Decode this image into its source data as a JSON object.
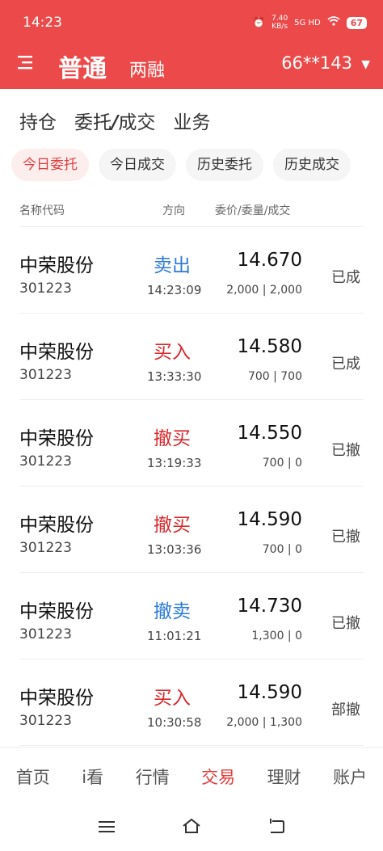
{
  "status_bar": {
    "time": "14:23",
    "speed": "7.40",
    "speed_unit": "KB/s",
    "network": "5G HD",
    "battery": "67"
  },
  "nav": {
    "mode_active": "普通",
    "mode_other": "两融",
    "account": "66**143"
  },
  "main_tabs": [
    {
      "label": "持仓"
    },
    {
      "label_a": "委托",
      "label_slash": "/",
      "label_b": "成交"
    },
    {
      "label": "业务"
    }
  ],
  "subtabs": [
    "今日委托",
    "今日成交",
    "历史委托",
    "历史成交"
  ],
  "columns": {
    "name": "名称代码",
    "direction": "方向",
    "price": "委价/委量/成交"
  },
  "orders": [
    {
      "name": "中荣股份",
      "code": "301223",
      "direction": "卖出",
      "time": "14:23:09",
      "price": "14.670",
      "qty": "2,000 | 2,000",
      "status": "已成"
    },
    {
      "name": "中荣股份",
      "code": "301223",
      "direction": "买入",
      "time": "13:33:30",
      "price": "14.580",
      "qty": "700 | 700",
      "status": "已成"
    },
    {
      "name": "中荣股份",
      "code": "301223",
      "direction": "撤买",
      "time": "13:19:33",
      "price": "14.550",
      "qty": "700 | 0",
      "status": "已撤"
    },
    {
      "name": "中荣股份",
      "code": "301223",
      "direction": "撤买",
      "time": "13:03:36",
      "price": "14.590",
      "qty": "700 | 0",
      "status": "已撤"
    },
    {
      "name": "中荣股份",
      "code": "301223",
      "direction": "撤卖",
      "time": "11:01:21",
      "price": "14.730",
      "qty": "1,300 | 0",
      "status": "已撤"
    },
    {
      "name": "中荣股份",
      "code": "301223",
      "direction": "买入",
      "time": "10:30:58",
      "price": "14.590",
      "qty": "2,000 | 1,300",
      "status": "部撤"
    }
  ],
  "bottom_nav": [
    "首页",
    "i看",
    "行情",
    "交易",
    "理财",
    "账户"
  ],
  "colors": {
    "brand": "#ec4a4a",
    "buy": "#d8282b",
    "sell": "#2a7ad8"
  }
}
